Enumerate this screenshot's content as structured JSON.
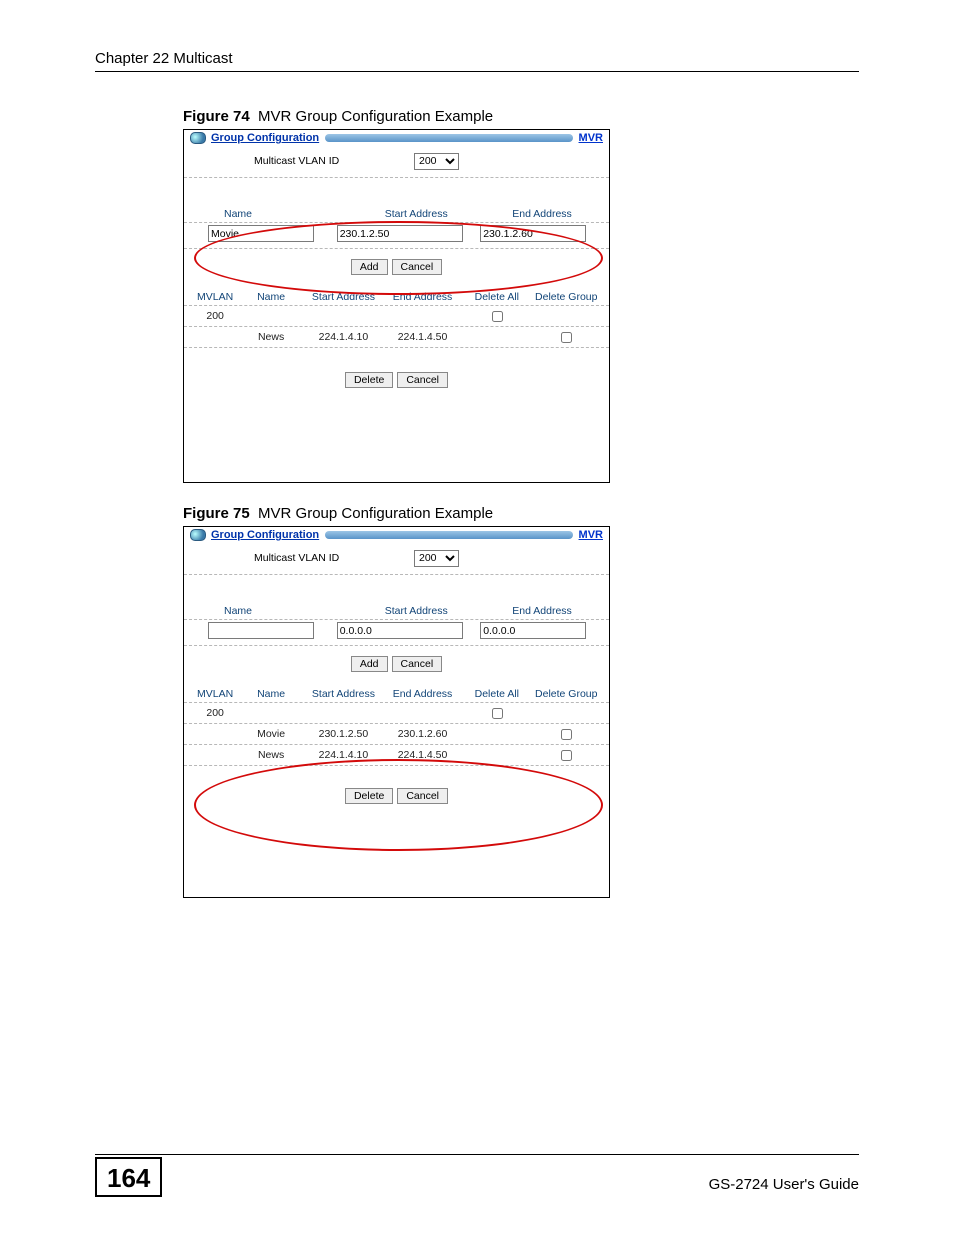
{
  "header": {
    "chapter": "Chapter 22 Multicast"
  },
  "figure74": {
    "caption_num": "Figure 74",
    "caption_text": "MVR Group Configuration Example",
    "panel_title": "Group Configuration",
    "top_link": "MVR",
    "mvid_label": "Multicast VLAN ID",
    "mvid_value": "200",
    "col_name": "Name",
    "col_start": "Start Address",
    "col_end": "End Address",
    "val_name": "Movie",
    "val_start": "230.1.2.50",
    "val_end": "230.1.2.60",
    "btn_add": "Add",
    "btn_cancel": "Cancel",
    "tbl": {
      "mvlan": "MVLAN",
      "name": "Name",
      "sa": "Start Address",
      "ea": "End Address",
      "da": "Delete All",
      "dg": "Delete Group"
    },
    "rows": [
      {
        "mvlan": "200",
        "name": "",
        "sa": "",
        "ea": ""
      },
      {
        "mvlan": "",
        "name": "News",
        "sa": "224.1.4.10",
        "ea": "224.1.4.50"
      }
    ],
    "btn_delete": "Delete",
    "btn_cancel2": "Cancel"
  },
  "figure75": {
    "caption_num": "Figure 75",
    "caption_text": "MVR Group Configuration Example",
    "panel_title": "Group Configuration",
    "top_link": "MVR",
    "mvid_label": "Multicast VLAN ID",
    "mvid_value": "200",
    "col_name": "Name",
    "col_start": "Start Address",
    "col_end": "End Address",
    "val_name": "",
    "val_start": "0.0.0.0",
    "val_end": "0.0.0.0",
    "btn_add": "Add",
    "btn_cancel": "Cancel",
    "tbl": {
      "mvlan": "MVLAN",
      "name": "Name",
      "sa": "Start Address",
      "ea": "End Address",
      "da": "Delete All",
      "dg": "Delete Group"
    },
    "rows": [
      {
        "mvlan": "200",
        "name": "",
        "sa": "",
        "ea": ""
      },
      {
        "mvlan": "",
        "name": "Movie",
        "sa": "230.1.2.50",
        "ea": "230.1.2.60"
      },
      {
        "mvlan": "",
        "name": "News",
        "sa": "224.1.4.10",
        "ea": "224.1.4.50"
      }
    ],
    "btn_delete": "Delete",
    "btn_cancel2": "Cancel"
  },
  "footer": {
    "page": "164",
    "guide": "GS-2724 User's Guide"
  }
}
